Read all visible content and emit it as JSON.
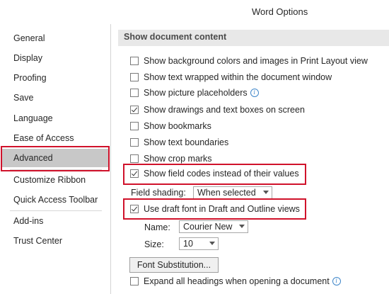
{
  "window": {
    "title": "Word Options"
  },
  "sidebar": {
    "items": [
      {
        "label": "General"
      },
      {
        "label": "Display"
      },
      {
        "label": "Proofing"
      },
      {
        "label": "Save"
      },
      {
        "label": "Language"
      },
      {
        "label": "Ease of Access"
      },
      {
        "label": "Advanced",
        "selected": true
      },
      {
        "label": "Customize Ribbon"
      },
      {
        "label": "Quick Access Toolbar"
      },
      {
        "label": "Add-ins"
      },
      {
        "label": "Trust Center"
      }
    ]
  },
  "content": {
    "section_title": "Show document content",
    "options": [
      {
        "label": "Show background colors and images in Print Layout view",
        "checked": false
      },
      {
        "label": "Show text wrapped within the document window",
        "checked": false
      },
      {
        "label": "Show picture placeholders",
        "checked": false,
        "info": true
      },
      {
        "label": "Show drawings and text boxes on screen",
        "checked": true
      },
      {
        "label": "Show bookmarks",
        "checked": false
      },
      {
        "label": "Show text boundaries",
        "checked": false
      },
      {
        "label": "Show crop marks",
        "checked": false
      },
      {
        "label": "Show field codes instead of their values",
        "checked": true
      }
    ],
    "field_shading": {
      "label": "Field shading:",
      "value": "When selected"
    },
    "draft_font": {
      "label": "Use draft font in Draft and Outline views",
      "checked": true
    },
    "name": {
      "label": "Name:",
      "value": "Courier New"
    },
    "size": {
      "label": "Size:",
      "value": "10"
    },
    "font_substitution_button": "Font Substitution...",
    "expand_headings": {
      "label": "Expand all headings when opening a document",
      "checked": false,
      "info": true
    }
  },
  "colors": {
    "highlight": "#d0122b",
    "selected_bg": "#c8c8c8",
    "section_bg": "#e8e8e8",
    "info_blue": "#3f86c9"
  }
}
